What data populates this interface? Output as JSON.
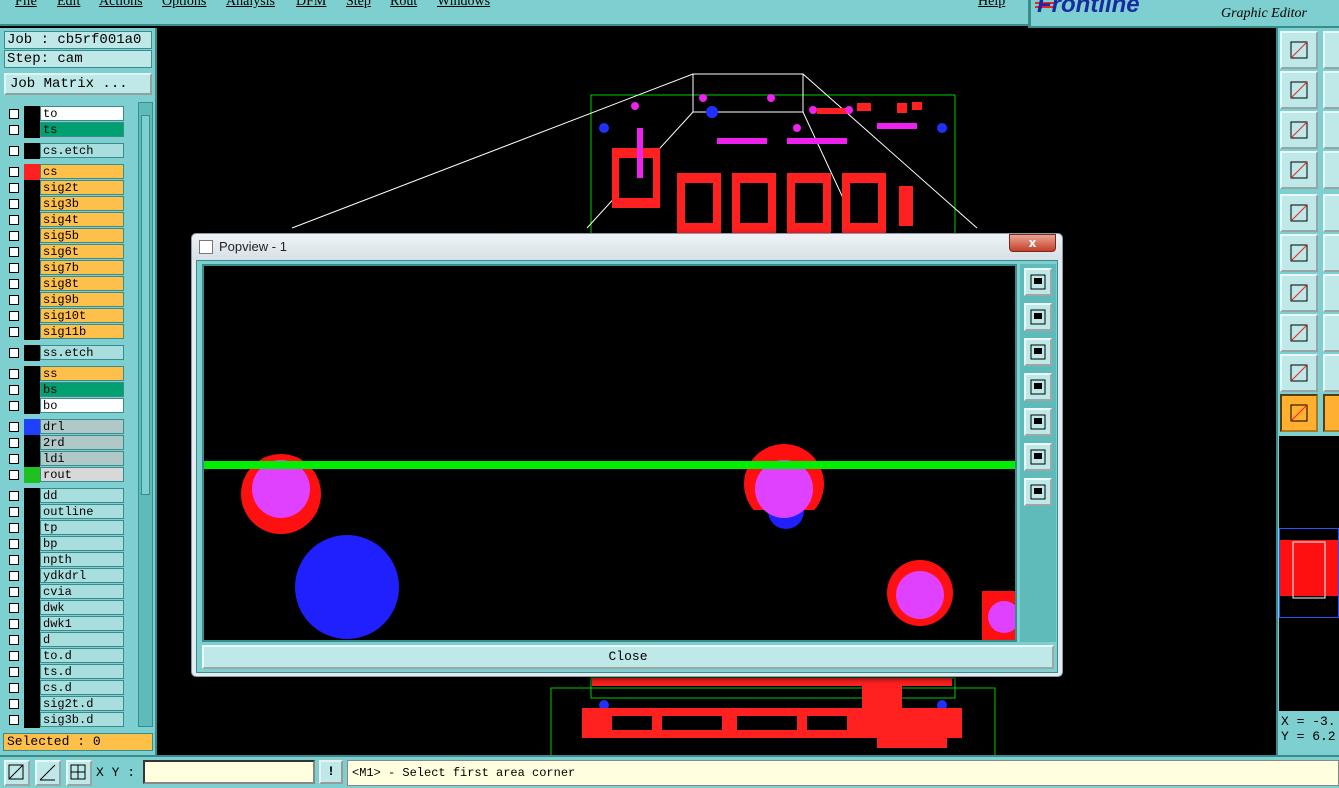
{
  "menubar": {
    "items": [
      "File",
      "Edit",
      "Actions",
      "Options",
      "Analysis",
      "DFM",
      "Step",
      "Rout",
      "Windows"
    ],
    "help": "Help"
  },
  "brand": {
    "logo": "Frontline",
    "subtitle": "Graphic Editor"
  },
  "leftpanel": {
    "job": "Job : cb5rf001a0",
    "step": "Step: cam",
    "job_matrix": "Job Matrix ...",
    "layers": [
      {
        "name": "to",
        "color": "white",
        "swatch": "#000000"
      },
      {
        "name": "ts",
        "color": "green",
        "swatch": "#000000"
      },
      {
        "name": "cs.etch",
        "color": "cyan",
        "swatch": "#000000"
      },
      {
        "name": "cs",
        "color": "orange",
        "swatch": "#ff2020"
      },
      {
        "name": "sig2t",
        "color": "orange",
        "swatch": "#000000"
      },
      {
        "name": "sig3b",
        "color": "orange",
        "swatch": "#000000"
      },
      {
        "name": "sig4t",
        "color": "orange",
        "swatch": "#000000"
      },
      {
        "name": "sig5b",
        "color": "orange",
        "swatch": "#000000"
      },
      {
        "name": "sig6t",
        "color": "orange",
        "swatch": "#000000"
      },
      {
        "name": "sig7b",
        "color": "orange",
        "swatch": "#000000"
      },
      {
        "name": "sig8t",
        "color": "orange",
        "swatch": "#000000"
      },
      {
        "name": "sig9b",
        "color": "orange",
        "swatch": "#000000"
      },
      {
        "name": "sig10t",
        "color": "orange",
        "swatch": "#000000"
      },
      {
        "name": "sig11b",
        "color": "orange",
        "swatch": "#000000"
      },
      {
        "name": "ss.etch",
        "color": "cyan",
        "swatch": "#000000"
      },
      {
        "name": "ss",
        "color": "orange",
        "swatch": "#000000"
      },
      {
        "name": "bs",
        "color": "green",
        "swatch": "#000000"
      },
      {
        "name": "bo",
        "color": "white",
        "swatch": "#000000"
      },
      {
        "name": "drl",
        "color": "grey",
        "swatch": "#2040ff"
      },
      {
        "name": "2rd",
        "color": "grey",
        "swatch": "#000000"
      },
      {
        "name": "ldi",
        "color": "grey",
        "swatch": "#000000"
      },
      {
        "name": "rout",
        "color": "lgrey",
        "swatch": "#20c020"
      },
      {
        "name": "dd",
        "color": "cyan",
        "swatch": "#000000"
      },
      {
        "name": "outline",
        "color": "cyan",
        "swatch": "#000000"
      },
      {
        "name": "tp",
        "color": "cyan",
        "swatch": "#000000"
      },
      {
        "name": "bp",
        "color": "cyan",
        "swatch": "#000000"
      },
      {
        "name": "npth",
        "color": "cyan",
        "swatch": "#000000"
      },
      {
        "name": "ydkdrl",
        "color": "cyan",
        "swatch": "#000000"
      },
      {
        "name": "cvia",
        "color": "cyan",
        "swatch": "#000000"
      },
      {
        "name": "dwk",
        "color": "cyan",
        "swatch": "#000000"
      },
      {
        "name": "dwk1",
        "color": "cyan",
        "swatch": "#000000"
      },
      {
        "name": "d",
        "color": "cyan",
        "swatch": "#000000"
      },
      {
        "name": "to.d",
        "color": "cyan",
        "swatch": "#000000"
      },
      {
        "name": "ts.d",
        "color": "cyan",
        "swatch": "#000000"
      },
      {
        "name": "cs.d",
        "color": "cyan",
        "swatch": "#000000"
      },
      {
        "name": "sig2t.d",
        "color": "cyan",
        "swatch": "#000000"
      },
      {
        "name": "sig3b.d",
        "color": "cyan",
        "swatch": "#000000"
      }
    ],
    "selected": "Selected : 0"
  },
  "popview": {
    "title": "Popview - 1",
    "close_x": "x",
    "close_label": "Close"
  },
  "coords": {
    "x": "X = -3.",
    "y": "Y = 6.2"
  },
  "statusbar": {
    "xy_label": "X Y :",
    "xy_value": "",
    "bang": "!",
    "prompt": "<M1> - Select first area corner"
  },
  "colors": {
    "panel": "#7ecfcf",
    "pad_red": "#ff1010",
    "pad_magenta": "#e040ff",
    "drill_blue": "#2020ff",
    "rout_green": "#00ee00"
  }
}
